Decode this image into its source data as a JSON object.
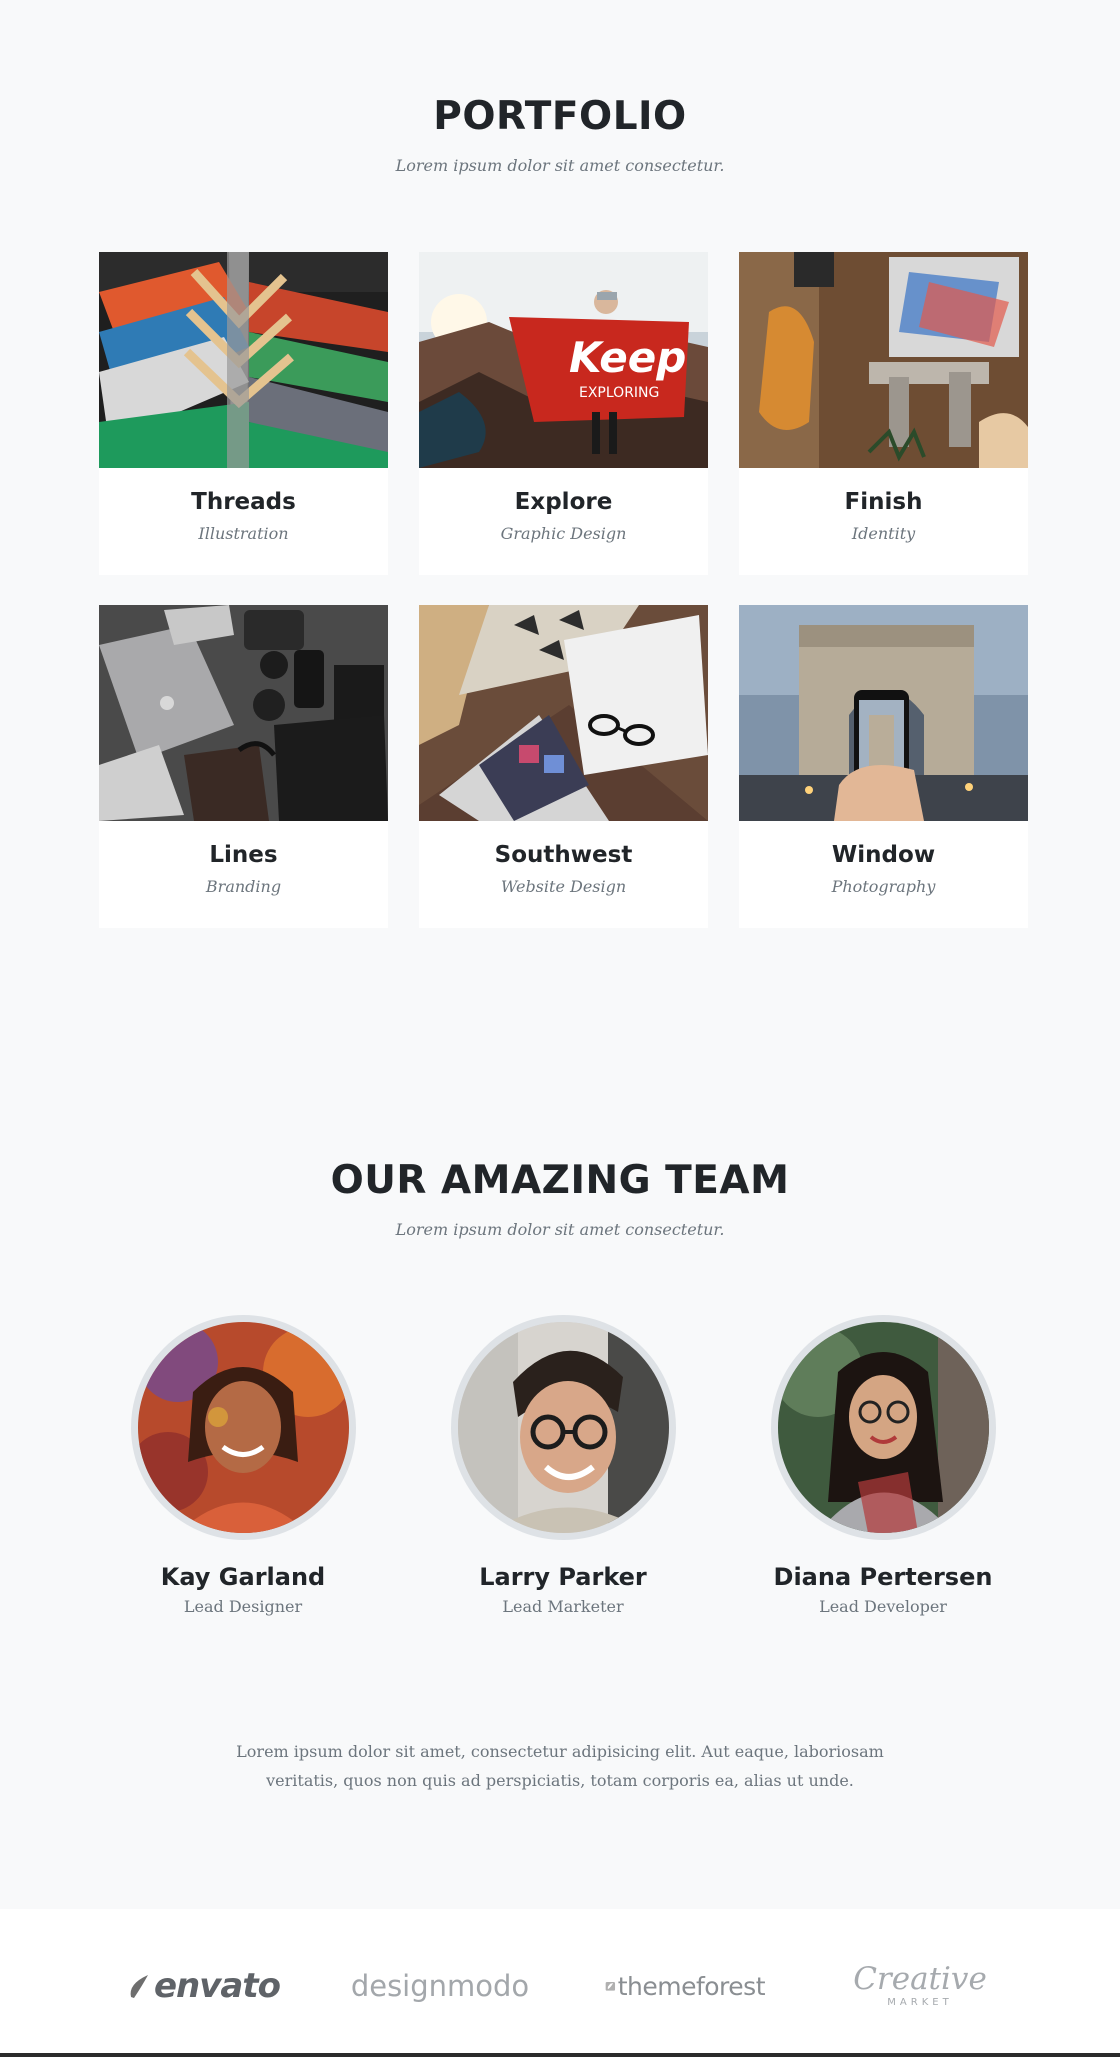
{
  "portfolio": {
    "heading": "PORTFOLIO",
    "subheading": "Lorem ipsum dolor sit amet consectetur.",
    "items": [
      {
        "title": "Threads",
        "category": "Illustration"
      },
      {
        "title": "Explore",
        "category": "Graphic Design"
      },
      {
        "title": "Finish",
        "category": "Identity"
      },
      {
        "title": "Lines",
        "category": "Branding"
      },
      {
        "title": "Southwest",
        "category": "Website Design"
      },
      {
        "title": "Window",
        "category": "Photography"
      }
    ]
  },
  "team": {
    "heading": "OUR AMAZING TEAM",
    "subheading": "Lorem ipsum dolor sit amet consectetur.",
    "members": [
      {
        "name": "Kay Garland",
        "role": "Lead Designer"
      },
      {
        "name": "Larry Parker",
        "role": "Lead Marketer"
      },
      {
        "name": "Diana Pertersen",
        "role": "Lead Developer"
      }
    ],
    "about": "Lorem ipsum dolor sit amet, consectetur adipisicing elit. Aut eaque, laboriosam veritatis, quos non quis ad perspiciatis, totam corporis ea, alias ut unde."
  },
  "clients": {
    "logos": [
      {
        "text": "envato"
      },
      {
        "text": "designmodo"
      },
      {
        "text": "themeforest"
      },
      {
        "text": "Creative",
        "subtext": "MARKET"
      }
    ]
  },
  "colors": {
    "background": "#f8f9fa",
    "heading": "#212529",
    "muted": "#6c757d",
    "avatar_border": "#dee2e6",
    "logo_gray": "#9aa0a6"
  }
}
